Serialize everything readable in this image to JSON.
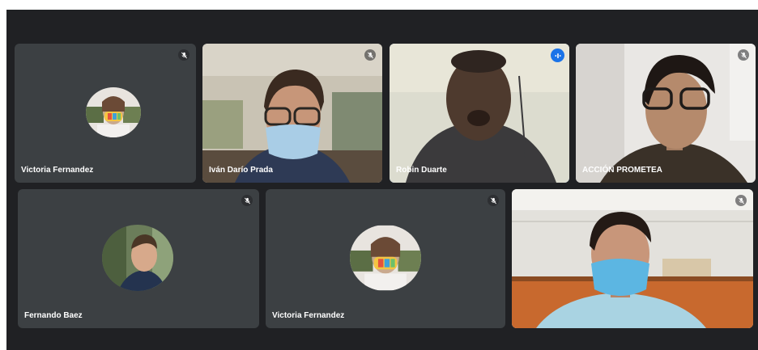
{
  "participants": [
    {
      "name": "Victoria Fernandez",
      "mic": "mic-off",
      "view": "avatar"
    },
    {
      "name": "Iván Darío Prada",
      "mic": "mic-off",
      "view": "video"
    },
    {
      "name": "Robin Duarte",
      "mic": "speaking",
      "view": "video"
    },
    {
      "name": "ACCIÓN PROMETEA",
      "mic": "mic-off",
      "view": "video"
    },
    {
      "name": "Fernando Baez",
      "mic": "mic-off",
      "view": "avatar"
    },
    {
      "name": "Victoria Fernandez",
      "mic": "mic-off",
      "view": "avatar"
    },
    {
      "name": "",
      "mic": "mic-off",
      "view": "video"
    }
  ],
  "colors": {
    "stage_background": "#202124",
    "tile_background": "#3c4043",
    "speaking_accent": "#1a73e8",
    "speaking_border": "#8ab4f8"
  }
}
